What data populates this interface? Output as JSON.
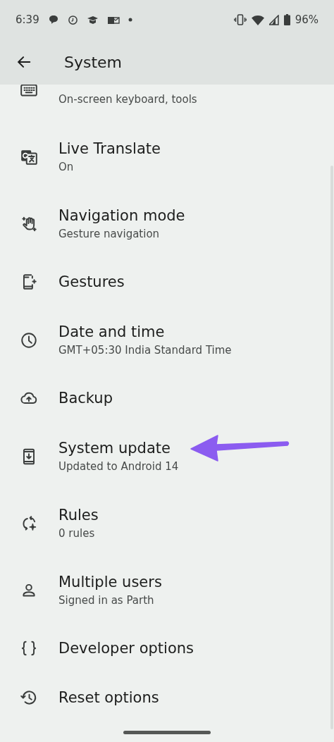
{
  "status_bar": {
    "time": "6:39",
    "battery": "96%"
  },
  "app_bar": {
    "title": "System"
  },
  "items": [
    {
      "subtitle": "On-screen keyboard, tools",
      "pointed": false
    },
    {
      "title": "Live Translate",
      "subtitle": "On",
      "pointed": false
    },
    {
      "title": "Navigation mode",
      "subtitle": "Gesture navigation",
      "pointed": false
    },
    {
      "title": "Gestures",
      "pointed": false
    },
    {
      "title": "Date and time",
      "subtitle": "GMT+05:30 India Standard Time",
      "pointed": false
    },
    {
      "title": "Backup",
      "pointed": false
    },
    {
      "title": "System update",
      "subtitle": "Updated to Android 14",
      "pointed": true
    },
    {
      "title": "Rules",
      "subtitle": "0 rules",
      "pointed": false
    },
    {
      "title": "Multiple users",
      "subtitle": "Signed in as Parth",
      "pointed": false
    },
    {
      "title": "Developer options",
      "pointed": false
    },
    {
      "title": "Reset options",
      "pointed": false
    }
  ]
}
